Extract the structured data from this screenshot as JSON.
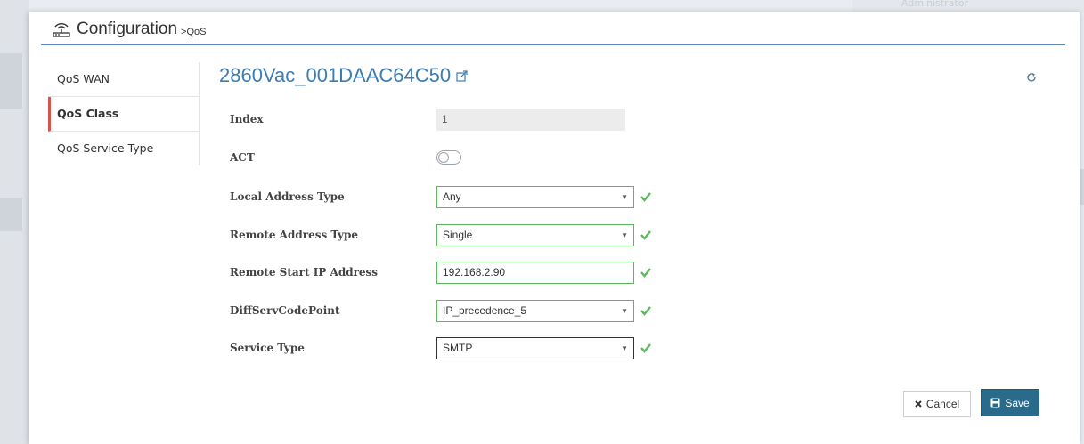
{
  "background": {
    "user_label": "Administrator"
  },
  "header": {
    "title": "Configuration",
    "subtitle": ">QoS",
    "icon": "router-icon"
  },
  "sidebar": {
    "items": [
      {
        "label": "QoS WAN",
        "active": false
      },
      {
        "label": "QoS Class",
        "active": true
      },
      {
        "label": "QoS Service Type",
        "active": false
      }
    ]
  },
  "main": {
    "device_name": "2860Vac_001DAAC64C50",
    "fields": {
      "index": {
        "label": "Index",
        "value": "1"
      },
      "act": {
        "label": "ACT",
        "value": false
      },
      "local_address_type": {
        "label": "Local Address Type",
        "value": "Any"
      },
      "remote_address_type": {
        "label": "Remote Address Type",
        "value": "Single"
      },
      "remote_start_ip": {
        "label": "Remote Start IP Address",
        "value": "192.168.2.90"
      },
      "diffserv": {
        "label": "DiffServCodePoint",
        "value": "IP_precedence_5"
      },
      "service_type": {
        "label": "Service Type",
        "value": "SMTP"
      }
    }
  },
  "buttons": {
    "cancel_label": "Cancel",
    "save_label": "Save"
  },
  "colors": {
    "accent": "#3d7cb3",
    "valid": "#5cb85c",
    "save": "#2a6b8b",
    "active_marker": "#d9534f"
  }
}
